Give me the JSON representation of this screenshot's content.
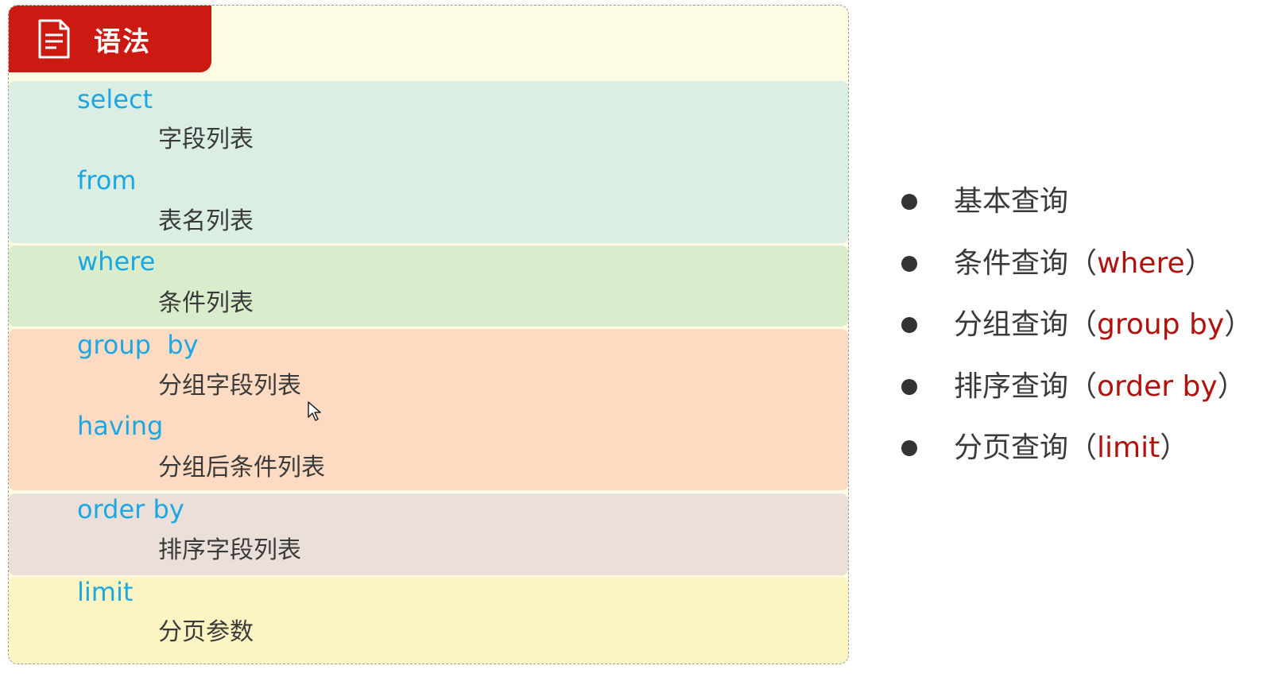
{
  "card": {
    "title": "语法",
    "clauses": [
      {
        "keyword": "select",
        "desc": "字段列表"
      },
      {
        "keyword": "from",
        "desc": "表名列表"
      },
      {
        "keyword": "where",
        "desc": "条件列表"
      },
      {
        "keyword": "group  by",
        "desc": "分组字段列表"
      },
      {
        "keyword": "having",
        "desc": "分组后条件列表"
      },
      {
        "keyword": "order by",
        "desc": "排序字段列表"
      },
      {
        "keyword": "limit",
        "desc": "分页参数"
      }
    ]
  },
  "topics": [
    {
      "label": "基本查询",
      "open": "",
      "keyword": "",
      "close": ""
    },
    {
      "label": "条件查询",
      "open": "（",
      "keyword": "where",
      "close": "）"
    },
    {
      "label": "分组查询",
      "open": "（",
      "keyword": "group by",
      "close": "）"
    },
    {
      "label": "排序查询",
      "open": "（",
      "keyword": "order by",
      "close": "）"
    },
    {
      "label": "分页查询",
      "open": "（",
      "keyword": "limit",
      "close": "）"
    }
  ],
  "colors": {
    "badge": "#cc1a12",
    "keyword": "#1ba8e2",
    "topic_keyword": "#b0120e",
    "band_select_from": "#dbeee4",
    "band_where": "#d9edcd",
    "band_group_having": "#fddbc3",
    "band_order": "#ebdfda",
    "band_limit": "#fcf4c2"
  },
  "icons": {
    "badge_icon": "document-icon",
    "cursor": "mouse-pointer-icon",
    "bullet": "bullet-dot-icon"
  }
}
